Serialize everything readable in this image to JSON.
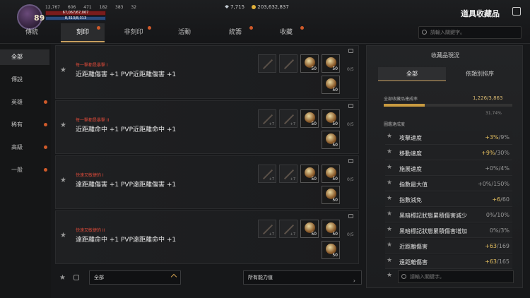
{
  "player": {
    "level": "89",
    "stat1": "12,767",
    "stat2": "606",
    "stat3": "471",
    "stat4": "182",
    "stat5": "383",
    "stat6": "32",
    "hp_text": "67,067/67,067",
    "mp_text": "8,313/8,313"
  },
  "currency": {
    "silver": "7,715",
    "gold": "203,632,837"
  },
  "window_title": "道具收藏品",
  "tabs": [
    {
      "label": "傳統",
      "dot": false
    },
    {
      "label": "刻印",
      "dot": true,
      "active": true
    },
    {
      "label": "非刻印",
      "dot": true
    },
    {
      "label": "活動",
      "dot": false
    },
    {
      "label": "統籌",
      "dot": true
    },
    {
      "label": "收藏",
      "dot": true
    }
  ],
  "search_placeholder": "請輸入關鍵字。",
  "sidebar": [
    {
      "label": "全部",
      "active": true,
      "dot": false
    },
    {
      "label": "傳說",
      "dot": false
    },
    {
      "label": "英雄",
      "dot": true
    },
    {
      "label": "稀有",
      "dot": true
    },
    {
      "label": "高級",
      "dot": true
    },
    {
      "label": "一般",
      "dot": true
    }
  ],
  "cards": [
    {
      "subtitle": "每一擊都是暴擊 I",
      "desc": "近距離傷害 +1 PVP近距離傷害 +1",
      "count": "0/5",
      "slot_plus": [
        "",
        ""
      ],
      "potions": [
        "50",
        "50",
        "50"
      ]
    },
    {
      "subtitle": "每一擊都是暴擊 II",
      "desc": "近距離命中 +1 PVP近距離命中 +1",
      "count": "0/5",
      "slot_plus": [
        "+7",
        "+7"
      ],
      "potions": [
        "50",
        "50",
        "50"
      ]
    },
    {
      "subtitle": "快速又敏捷的 I",
      "desc": "遠距離傷害 +1 PVP遠距離傷害 +1",
      "count": "0/5",
      "slot_plus": [
        "+7",
        "+7"
      ],
      "potions": [
        "50",
        "50",
        "50"
      ]
    },
    {
      "subtitle": "快速又敏捷的 II",
      "desc": "遠距離命中 +1 PVP遠距離命中 +1",
      "count": "0/5",
      "slot_plus": [
        "+7",
        "+7"
      ],
      "potions": [
        "50",
        "50",
        "50"
      ]
    }
  ],
  "bottom": {
    "filter_left": "全部",
    "filter_right": "所有能力值"
  },
  "right_panel": {
    "title": "收藏品現況",
    "tab_all": "全部",
    "tab_sort": "依類別排序",
    "rate_label": "全部收藏品達成率",
    "rate_value": "1,226/3,863",
    "rate_fraction": 0.3174,
    "rate_pct": "31.74%",
    "section_label": "圖鑑達成度",
    "stats": [
      {
        "name": "攻擊速度",
        "cur": "+3%",
        "max": "/9%",
        "highlight": true
      },
      {
        "name": "移動速度",
        "cur": "+9%",
        "max": "/30%",
        "highlight": true
      },
      {
        "name": "施展速度",
        "cur": "+0%",
        "max": "/4%",
        "highlight": false
      },
      {
        "name": "指數最大值",
        "cur": "+0%",
        "max": "/150%",
        "highlight": false
      },
      {
        "name": "指數減免",
        "cur": "+6",
        "max": "/60",
        "highlight": true
      },
      {
        "name": "黑暗標記狀態累積傷害減少",
        "cur": "0%",
        "max": "/10%",
        "highlight": false
      },
      {
        "name": "黑暗標記狀態累積傷害增加",
        "cur": "0%",
        "max": "/3%",
        "highlight": false
      },
      {
        "name": "近距離傷害",
        "cur": "+63",
        "max": "/169",
        "highlight": true
      },
      {
        "name": "遠距離傷害",
        "cur": "+63",
        "max": "/165",
        "highlight": true
      }
    ],
    "search_placeholder": "請輸入關鍵字。"
  }
}
